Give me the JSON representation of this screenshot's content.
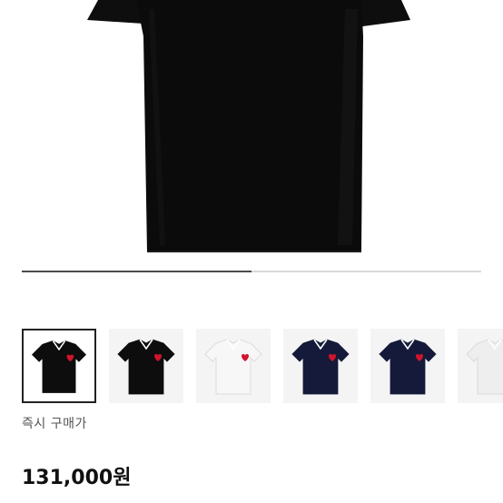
{
  "product": {
    "price_label": "즉시 구매가",
    "price_value": "131,000원",
    "heart_color": "#d0142c"
  },
  "gallery": {
    "progress": 0.5,
    "selected_index": 0,
    "thumbnails": [
      {
        "shirt_color": "#0d0d0d",
        "icon": "polo-shirt-black-icon"
      },
      {
        "shirt_color": "#0d0d0d",
        "icon": "polo-shirt-black-icon"
      },
      {
        "shirt_color": "#f7f7f7",
        "icon": "polo-shirt-white-icon"
      },
      {
        "shirt_color": "#151a3a",
        "icon": "polo-shirt-navy-icon"
      },
      {
        "shirt_color": "#151a3a",
        "icon": "polo-shirt-navy-icon"
      },
      {
        "shirt_color": "#eeeeee",
        "icon": "polo-shirt-white-icon"
      }
    ]
  }
}
